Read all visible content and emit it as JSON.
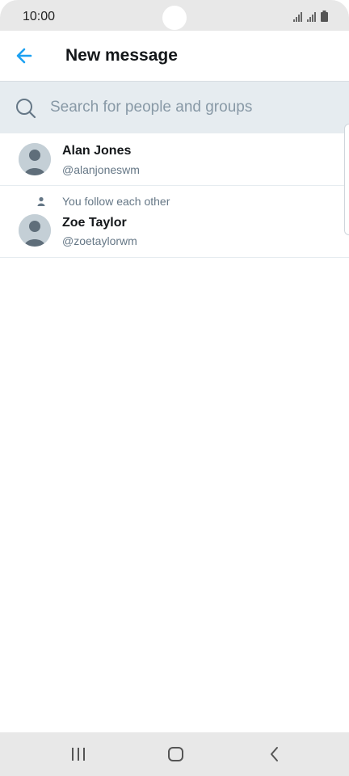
{
  "status_bar": {
    "time": "10:00",
    "icons": [
      "signal-icon",
      "signal-icon",
      "battery-icon"
    ]
  },
  "header": {
    "title": "New message",
    "back_icon": "arrow-left-icon",
    "accent_color": "#1da1f2"
  },
  "search": {
    "placeholder": "Search for people and groups",
    "value": "",
    "icon": "search-icon"
  },
  "results": [
    {
      "name": "Alan Jones",
      "handle": "@alanjoneswm",
      "follow_status": ""
    },
    {
      "name": "Zoe Taylor",
      "handle": "@zoetaylorwm",
      "follow_status": "You follow each other"
    }
  ],
  "nav_bar": {
    "buttons": [
      "recents-icon",
      "home-icon",
      "back-icon"
    ]
  }
}
